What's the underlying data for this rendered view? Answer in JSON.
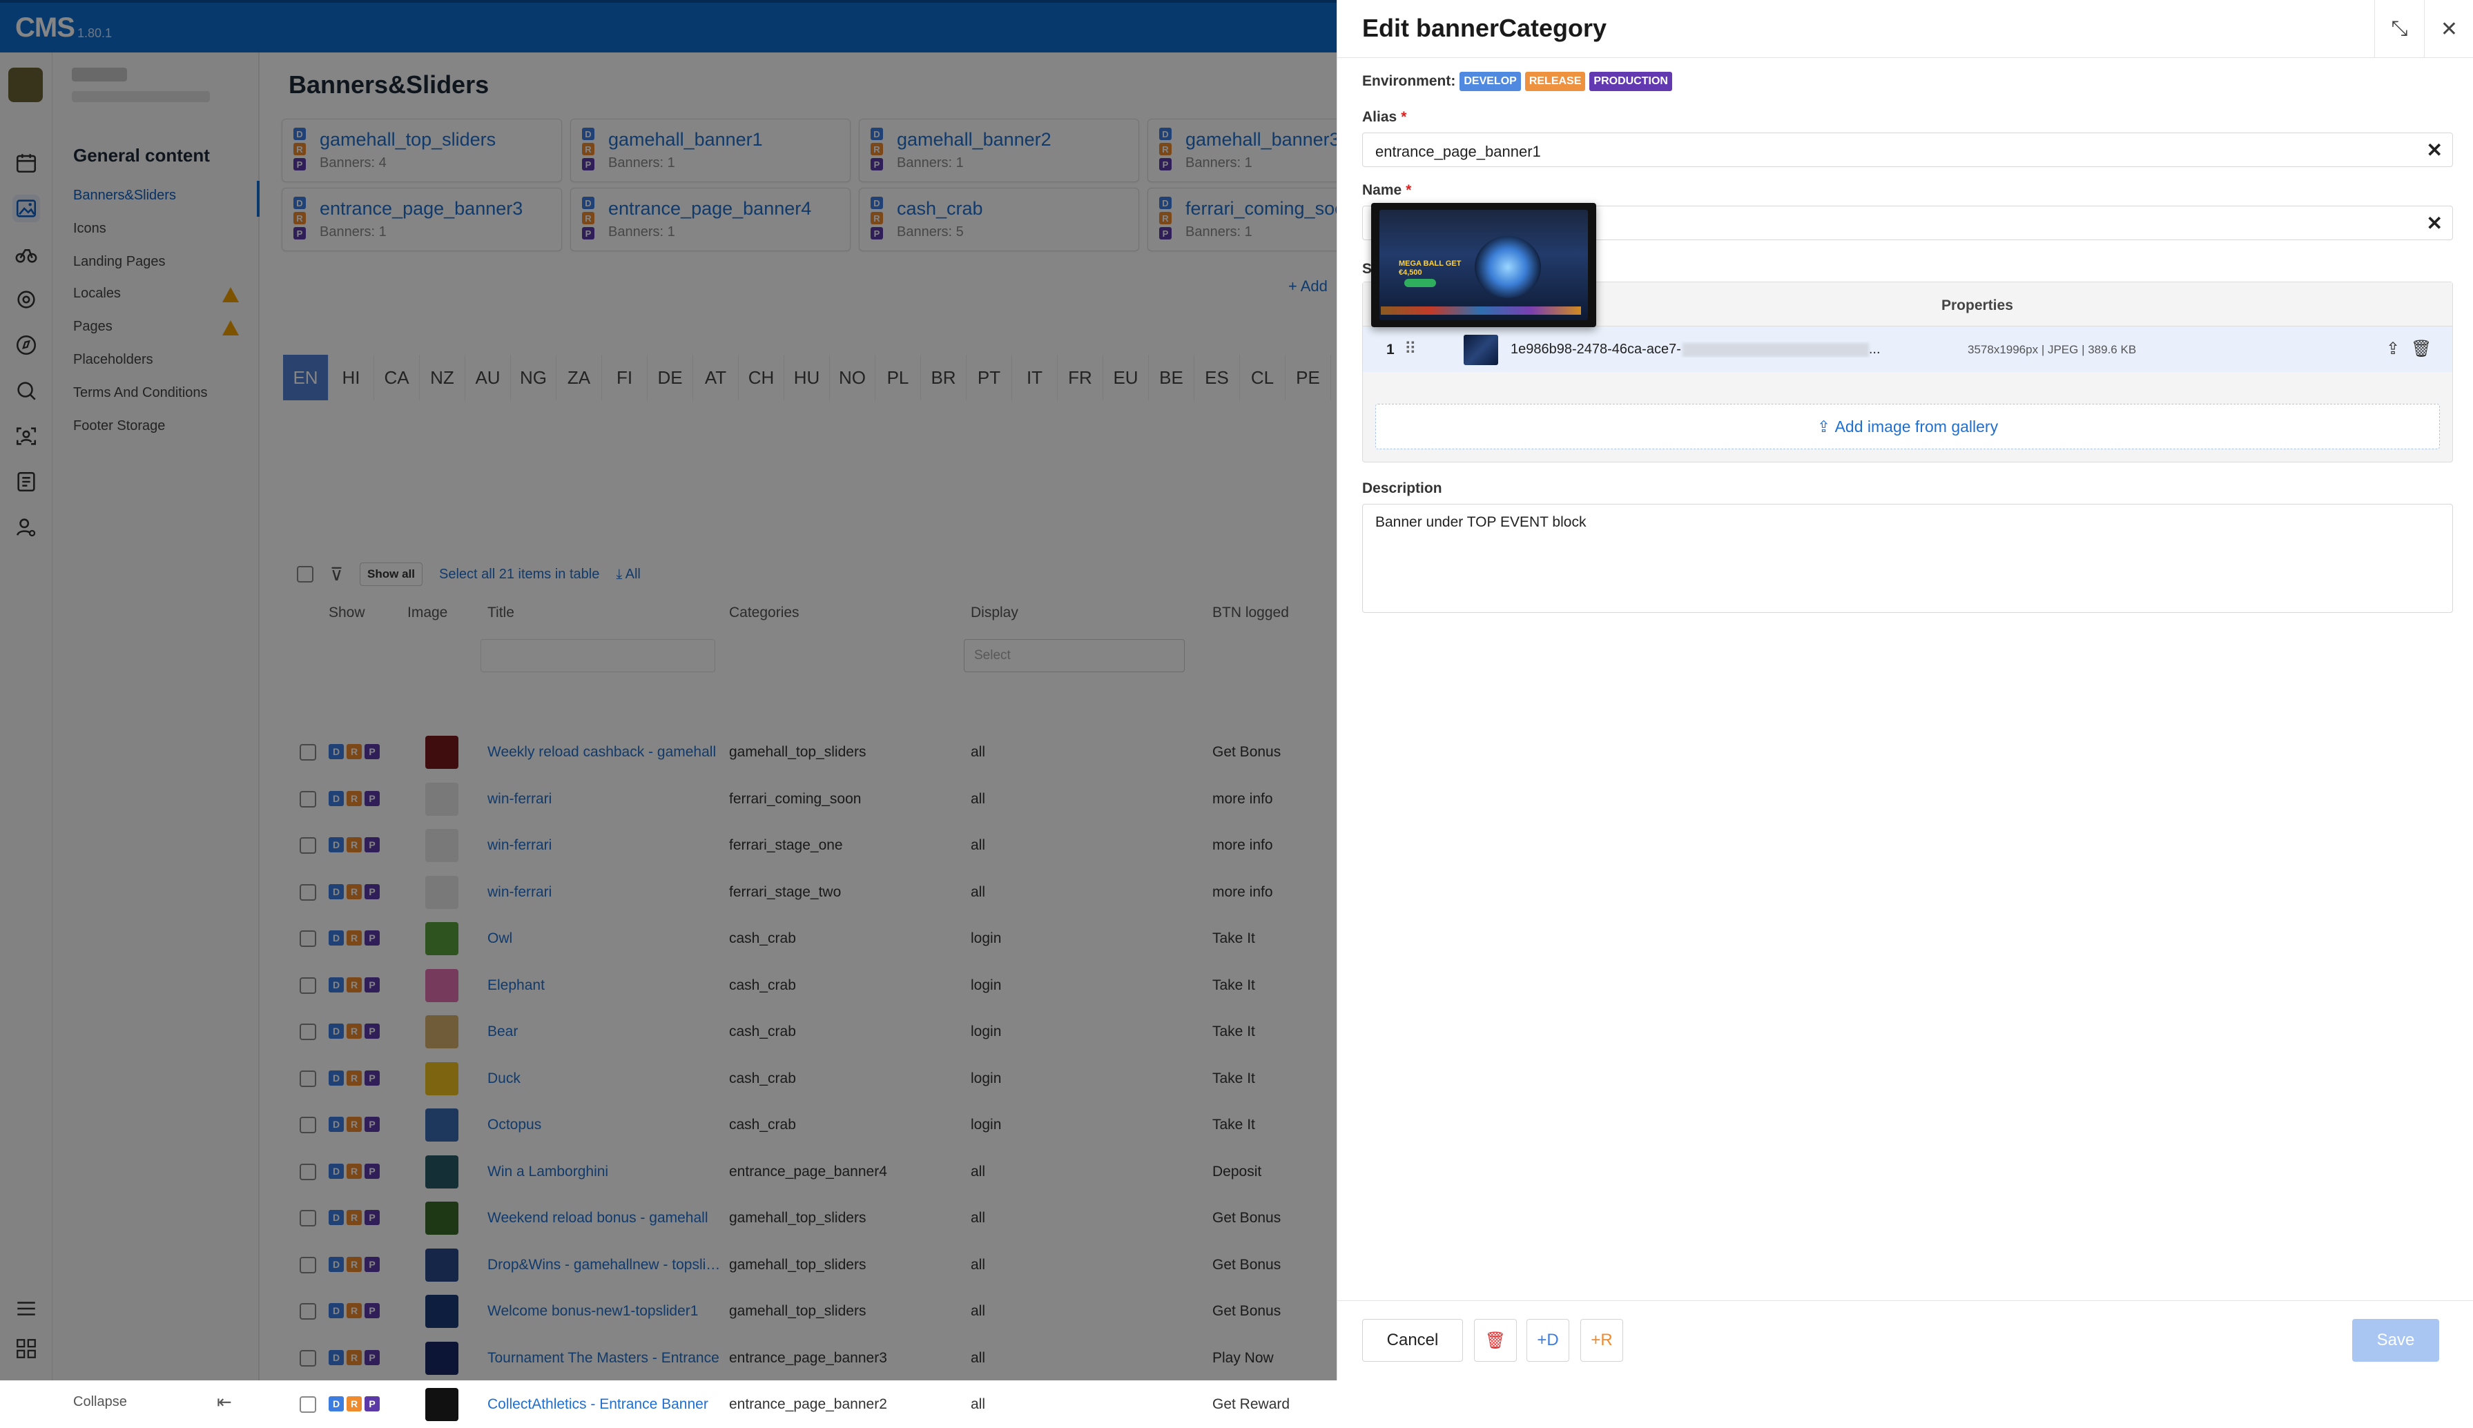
{
  "app": {
    "logo": "CMS",
    "version": "1.80.1"
  },
  "nav": {
    "header": "General content",
    "items": [
      {
        "label": "Banners&Sliders"
      },
      {
        "label": "Icons"
      },
      {
        "label": "Landing Pages"
      },
      {
        "label": "Locales"
      },
      {
        "label": "Pages"
      },
      {
        "label": "Placeholders"
      },
      {
        "label": "Terms And Conditions"
      },
      {
        "label": "Footer Storage"
      }
    ],
    "collapse_label": "Collapse"
  },
  "main": {
    "title": "Banners&Sliders",
    "cards": [
      {
        "name": "gamehall_top_sliders",
        "sub": "Banners: 4"
      },
      {
        "name": "gamehall_banner1",
        "sub": "Banners: 1"
      },
      {
        "name": "gamehall_banner2",
        "sub": "Banners: 1"
      },
      {
        "name": "gamehall_banner3",
        "sub": "Banners: 1"
      },
      {
        "name": "entrance_page_banner3",
        "sub": "Banners: 1"
      },
      {
        "name": "entrance_page_banner4",
        "sub": "Banners: 1"
      },
      {
        "name": "cash_crab",
        "sub": "Banners: 5"
      },
      {
        "name": "ferrari_coming_soon",
        "sub": "Banners: 1"
      }
    ],
    "pill_letters": {
      "d": "D",
      "r": "R",
      "p": "P"
    },
    "add_label": "+ Add",
    "languages": [
      "EN",
      "HI",
      "CA",
      "NZ",
      "AU",
      "NG",
      "ZA",
      "FI",
      "DE",
      "AT",
      "CH",
      "HU",
      "NO",
      "PL",
      "BR",
      "PT",
      "IT",
      "FR",
      "EU",
      "BE",
      "ES",
      "CL",
      "PE"
    ],
    "active_language": "EN",
    "filterbar": {
      "show_all": "Show all",
      "select_all": "Select all 21 items in table",
      "download": "All"
    },
    "table": {
      "headers": {
        "show": "Show",
        "image": "Image",
        "title": "Title",
        "categories": "Categories",
        "display": "Display",
        "btn": "BTN logged"
      },
      "display_placeholder": "Select",
      "rows": [
        {
          "title": "Weekly reload cashback - gamehall",
          "category": "gamehall_top_sliders",
          "display": "all",
          "btn": "Get Bonus",
          "thumb_color": "#7a1a1a"
        },
        {
          "title": "win-ferrari",
          "category": "ferrari_coming_soon",
          "display": "all",
          "btn": "more info",
          "thumb_color": "#e8e8e8"
        },
        {
          "title": "win-ferrari",
          "category": "ferrari_stage_one",
          "display": "all",
          "btn": "more info",
          "thumb_color": "#e8e8e8"
        },
        {
          "title": "win-ferrari",
          "category": "ferrari_stage_two",
          "display": "all",
          "btn": "more info",
          "thumb_color": "#e8e8e8"
        },
        {
          "title": "Owl",
          "category": "cash_crab",
          "display": "login",
          "btn": "Take It",
          "thumb_color": "#5aa03a"
        },
        {
          "title": "Elephant",
          "category": "cash_crab",
          "display": "login",
          "btn": "Take It",
          "thumb_color": "#e070b0"
        },
        {
          "title": "Bear",
          "category": "cash_crab",
          "display": "login",
          "btn": "Take It",
          "thumb_color": "#d8b070"
        },
        {
          "title": "Duck",
          "category": "cash_crab",
          "display": "login",
          "btn": "Take It",
          "thumb_color": "#f0c020"
        },
        {
          "title": "Octopus",
          "category": "cash_crab",
          "display": "login",
          "btn": "Take It",
          "thumb_color": "#3a6ab0"
        },
        {
          "title": "Win a Lamborghini",
          "category": "entrance_page_banner4",
          "display": "all",
          "btn": "Deposit",
          "thumb_color": "#2a5a6a"
        },
        {
          "title": "Weekend reload bonus - gamehall",
          "category": "gamehall_top_sliders",
          "display": "all",
          "btn": "Get Bonus",
          "thumb_color": "#3a6a2a"
        },
        {
          "title": "Drop&Wins - gamehallnew - topsliders",
          "category": "gamehall_top_sliders",
          "display": "all",
          "btn": "Get Bonus",
          "thumb_color": "#2a4a8a"
        },
        {
          "title": "Welcome bonus-new1-topslider1",
          "category": "gamehall_top_sliders",
          "display": "all",
          "btn": "Get Bonus",
          "thumb_color": "#1a3a7a"
        },
        {
          "title": "Tournament The Masters - Entrance",
          "category": "entrance_page_banner3",
          "display": "all",
          "btn": "Play Now",
          "thumb_color": "#1a2a6a"
        },
        {
          "title": "CollectAthletics - Entrance Banner",
          "category": "entrance_page_banner2",
          "display": "all",
          "btn": "Get Reward",
          "thumb_color": "#111"
        }
      ]
    }
  },
  "drawer": {
    "title": "Edit bannerCategory",
    "environment_label": "Environment:",
    "env_tags": [
      "DEVELOP",
      "RELEASE",
      "PRODUCTION"
    ],
    "alias_label": "Alias",
    "alias_value": "entrance_page_banner1",
    "name_label": "Name",
    "name_value": "",
    "slides_label": "S",
    "properties_header": "Properties",
    "slide": {
      "index": "1",
      "filename": "1e986b98-2478-46ca-ace7-",
      "filename_tail": "...",
      "properties": "3578x1996px | JPEG | 389.6 KB"
    },
    "add_image_label": "Add image from gallery",
    "preview_text": "MEGA BALL GET €4,500",
    "description_label": "Description",
    "description_value": "Banner under TOP EVENT block",
    "buttons": {
      "cancel": "Cancel",
      "to_develop": "+D",
      "to_release": "+R",
      "save": "Save"
    }
  },
  "colors": {
    "primary": "#0f6dd0",
    "develop": "#4f8ae0",
    "release": "#ee9240",
    "production": "#6239b0",
    "danger": "#e03030"
  }
}
